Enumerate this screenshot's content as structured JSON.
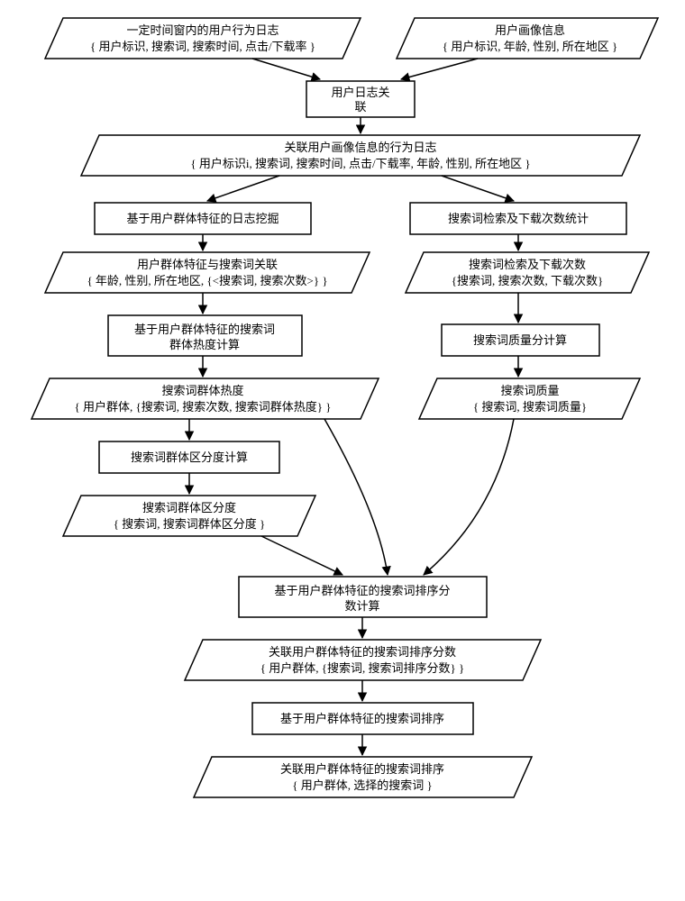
{
  "d1": {
    "l1": "一定时间窗内的用户行为日志",
    "l2": "{ 用户标识, 搜索词, 搜索时间, 点击/下载率 }"
  },
  "d2": {
    "l1": "用户画像信息",
    "l2": "{ 用户标识, 年龄, 性别, 所在地区 }"
  },
  "p1": {
    "l1": "用户日志关",
    "l2": "联"
  },
  "d3": {
    "l1": "关联用户画像信息的行为日志",
    "l2": "{ 用户标识i, 搜索词, 搜索时间, 点击/下载率, 年龄, 性别, 所在地区 }"
  },
  "p2": {
    "l1": "基于用户群体特征的日志挖掘"
  },
  "p3": {
    "l1": "搜索词检索及下载次数统计"
  },
  "d4": {
    "l1": "用户群体特征与搜索词关联",
    "l2": "{  年龄, 性别, 所在地区,  {<搜索词, 搜索次数>}   }"
  },
  "d5": {
    "l1": "搜索词检索及下载次数",
    "l2": "{搜索词, 搜索次数, 下载次数}"
  },
  "p4": {
    "l1": "基于用户群体特征的搜索词",
    "l2": "群体热度计算"
  },
  "p5": {
    "l1": "搜索词质量分计算"
  },
  "d6": {
    "l1": "搜索词群体热度",
    "l2": "{ 用户群体,  {搜索词, 搜索次数, 搜索词群体热度} }"
  },
  "d7": {
    "l1": "搜索词质量",
    "l2": "{ 搜索词, 搜索词质量}"
  },
  "p6": {
    "l1": "搜索词群体区分度计算"
  },
  "d8": {
    "l1": "搜索词群体区分度",
    "l2": "{ 搜索词, 搜索词群体区分度 }"
  },
  "p7": {
    "l1": "基于用户群体特征的搜索词排序分",
    "l2": "数计算"
  },
  "d9": {
    "l1": "关联用户群体特征的搜索词排序分数",
    "l2": "{ 用户群体,  {搜索词, 搜索词排序分数} }"
  },
  "p8": {
    "l1": "基于用户群体特征的搜索词排序"
  },
  "d10": {
    "l1": "关联用户群体特征的搜索词排序",
    "l2": "{ 用户群体,  选择的搜索词 }"
  },
  "chart_data": {
    "type": "flowchart",
    "nodes": [
      {
        "id": "d1",
        "kind": "data",
        "label": "一定时间窗内的用户行为日志 {用户标识,搜索词,搜索时间,点击/下载率}"
      },
      {
        "id": "d2",
        "kind": "data",
        "label": "用户画像信息 {用户标识,年龄,性别,所在地区}"
      },
      {
        "id": "p1",
        "kind": "process",
        "label": "用户日志关联"
      },
      {
        "id": "d3",
        "kind": "data",
        "label": "关联用户画像信息的行为日志 {用户标识i,搜索词,搜索时间,点击/下载率,年龄,性别,所在地区}"
      },
      {
        "id": "p2",
        "kind": "process",
        "label": "基于用户群体特征的日志挖掘"
      },
      {
        "id": "p3",
        "kind": "process",
        "label": "搜索词检索及下载次数统计"
      },
      {
        "id": "d4",
        "kind": "data",
        "label": "用户群体特征与搜索词关联 {年龄,性别,所在地区,{<搜索词,搜索次数>}}"
      },
      {
        "id": "d5",
        "kind": "data",
        "label": "搜索词检索及下载次数 {搜索词,搜索次数,下载次数}"
      },
      {
        "id": "p4",
        "kind": "process",
        "label": "基于用户群体特征的搜索词群体热度计算"
      },
      {
        "id": "p5",
        "kind": "process",
        "label": "搜索词质量分计算"
      },
      {
        "id": "d6",
        "kind": "data",
        "label": "搜索词群体热度 {用户群体,{搜索词,搜索次数,搜索词群体热度}}"
      },
      {
        "id": "d7",
        "kind": "data",
        "label": "搜索词质量 {搜索词,搜索词质量}"
      },
      {
        "id": "p6",
        "kind": "process",
        "label": "搜索词群体区分度计算"
      },
      {
        "id": "d8",
        "kind": "data",
        "label": "搜索词群体区分度 {搜索词,搜索词群体区分度}"
      },
      {
        "id": "p7",
        "kind": "process",
        "label": "基于用户群体特征的搜索词排序分数计算"
      },
      {
        "id": "d9",
        "kind": "data",
        "label": "关联用户群体特征的搜索词排序分数 {用户群体,{搜索词,搜索词排序分数}}"
      },
      {
        "id": "p8",
        "kind": "process",
        "label": "基于用户群体特征的搜索词排序"
      },
      {
        "id": "d10",
        "kind": "data",
        "label": "关联用户群体特征的搜索词排序 {用户群体,选择的搜索词}"
      }
    ],
    "edges": [
      [
        "d1",
        "p1"
      ],
      [
        "d2",
        "p1"
      ],
      [
        "p1",
        "d3"
      ],
      [
        "d3",
        "p2"
      ],
      [
        "d3",
        "p3"
      ],
      [
        "p2",
        "d4"
      ],
      [
        "p3",
        "d5"
      ],
      [
        "d4",
        "p4"
      ],
      [
        "d5",
        "p5"
      ],
      [
        "p4",
        "d6"
      ],
      [
        "p5",
        "d7"
      ],
      [
        "d6",
        "p6"
      ],
      [
        "p6",
        "d8"
      ],
      [
        "d6",
        "p7"
      ],
      [
        "d7",
        "p7"
      ],
      [
        "d8",
        "p7"
      ],
      [
        "p7",
        "d9"
      ],
      [
        "d9",
        "p8"
      ],
      [
        "p8",
        "d10"
      ]
    ]
  }
}
